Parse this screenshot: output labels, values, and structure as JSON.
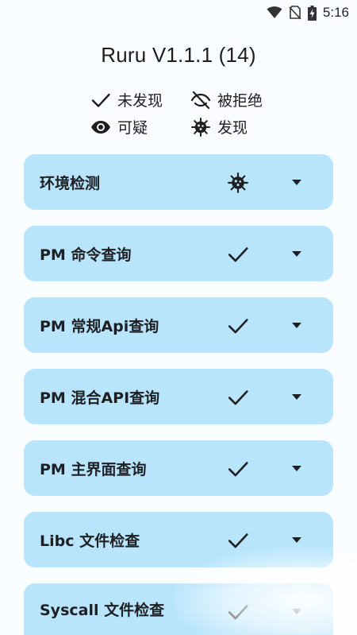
{
  "status_bar": {
    "time": "5:16",
    "icons": [
      "wifi-icon",
      "no-sim-icon",
      "battery-charging-icon"
    ]
  },
  "app": {
    "title": "Ruru V1.1.1 (14)"
  },
  "legend": {
    "not_found": {
      "icon": "check-icon",
      "label": "未发现"
    },
    "denied": {
      "icon": "eye-off-icon",
      "label": "被拒绝"
    },
    "suspicious": {
      "icon": "eye-icon",
      "label": "可疑"
    },
    "found": {
      "icon": "virus-icon",
      "label": "发现"
    }
  },
  "cards": [
    {
      "title": "环境检测",
      "status": "virus-icon"
    },
    {
      "title": "PM 命令查询",
      "status": "check-icon"
    },
    {
      "title": "PM 常规Api查询",
      "status": "check-icon"
    },
    {
      "title": "PM 混合API查询",
      "status": "check-icon"
    },
    {
      "title": "PM 主界面查询",
      "status": "check-icon"
    },
    {
      "title": "Libc 文件检查",
      "status": "check-icon"
    },
    {
      "title": "Syscall 文件检查",
      "status": "check-icon"
    }
  ],
  "colors": {
    "background": "#fafdff",
    "card": "#b8e5fc",
    "text": "#1e1f22"
  }
}
